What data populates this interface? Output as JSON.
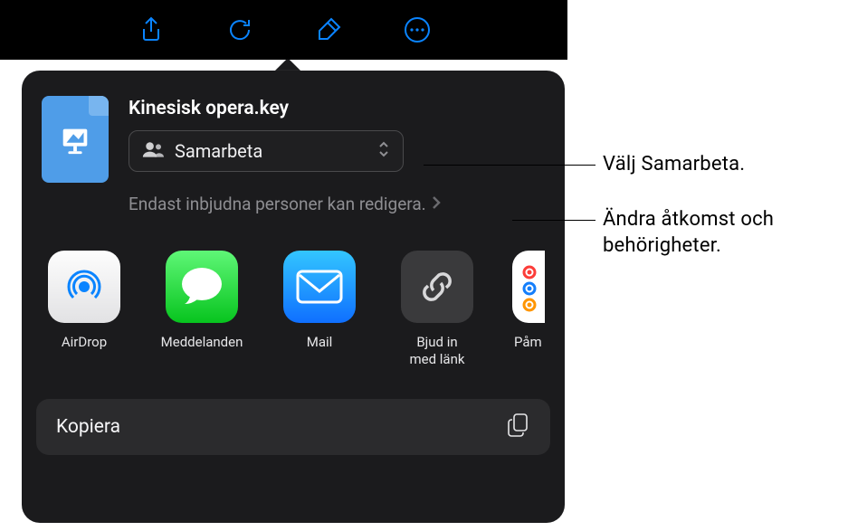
{
  "toolbar": {
    "icons": [
      "share-icon",
      "undo-icon",
      "paintbrush-icon",
      "more-icon"
    ]
  },
  "document": {
    "title": "Kinesisk opera.key"
  },
  "collab": {
    "mode_label": "Samarbeta"
  },
  "permissions": {
    "summary": "Endast inbjudna personer kan redigera."
  },
  "apps": [
    {
      "name": "airdrop",
      "label": "AirDrop"
    },
    {
      "name": "messages",
      "label": "Meddelanden"
    },
    {
      "name": "mail",
      "label": "Mail"
    },
    {
      "name": "invitelink",
      "label": "Bjud in\nmed länk"
    },
    {
      "name": "reminders",
      "label": "Påm"
    }
  ],
  "actions": {
    "copy_label": "Kopiera"
  },
  "callouts": {
    "collab": "Välj Samarbeta.",
    "permissions": "Ändra åtkomst och behörigheter."
  }
}
